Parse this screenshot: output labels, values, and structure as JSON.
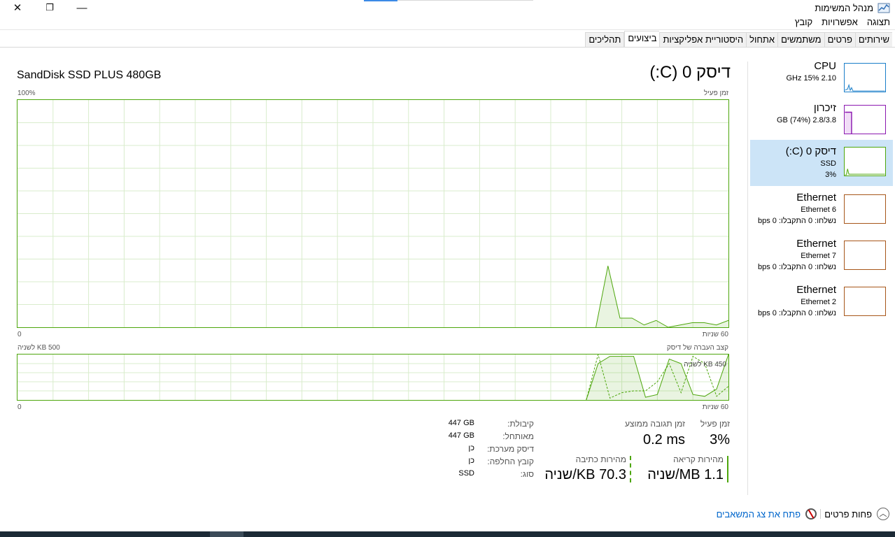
{
  "window": {
    "title": "מנהל המשימות",
    "controls": {
      "close": "✕",
      "restore": "❐",
      "minimize": "—"
    }
  },
  "menu": [
    "קובץ",
    "אפשרויות",
    "תצוגה"
  ],
  "tabs": [
    {
      "label": "תהליכים",
      "active": false
    },
    {
      "label": "ביצועים",
      "active": true
    },
    {
      "label": "היסטוריית אפליקציות",
      "active": false
    },
    {
      "label": "אתחול",
      "active": false
    },
    {
      "label": "משתמשים",
      "active": false
    },
    {
      "label": "פרטים",
      "active": false
    },
    {
      "label": "שירותים",
      "active": false
    }
  ],
  "resources": [
    {
      "name": "CPU",
      "line1": "2.10 GHz  15%",
      "line2": "",
      "color": "#1a7ec9",
      "selected": false
    },
    {
      "name": "זיכרון",
      "line1": "2.8/3.8 GB (74%)",
      "line2": "",
      "color": "#8b18b0",
      "selected": false
    },
    {
      "name": "דיסק 0 (C:)",
      "line1": "SSD",
      "line2": "3%",
      "color": "#4da60c",
      "selected": true
    },
    {
      "name": "Ethernet",
      "line1": "Ethernet 6",
      "line2": "נשלחו: 0 התקבלו: 0 bps",
      "color": "#a7561a",
      "selected": false
    },
    {
      "name": "Ethernet",
      "line1": "Ethernet 7",
      "line2": "נשלחו: 0 התקבלו: 0 bps",
      "color": "#a7561a",
      "selected": false
    },
    {
      "name": "Ethernet",
      "line1": "Ethernet 2",
      "line2": "נשלחו: 0 התקבלו: 0 bps",
      "color": "#a7561a",
      "selected": false
    }
  ],
  "disk": {
    "title": "דיסק 0 (C:)",
    "model": "SandDisk SSD PLUS 480GB",
    "active_time_label": "זמן פעיל",
    "active_time_max": "100%",
    "x_left_label": "60 שניות",
    "x_right_label": "0",
    "transfer_label": "קצב העברה של דיסק",
    "transfer_max": "500 KB לשניה",
    "transfer_marker": "450 KB לשניה",
    "active_time_series": [
      0,
      0,
      0,
      0,
      0,
      0,
      0,
      0,
      0,
      0,
      0,
      0,
      0,
      0,
      0,
      0,
      0,
      0,
      0,
      0,
      0,
      0,
      0,
      0,
      0,
      0,
      0,
      0,
      0,
      0,
      0,
      0,
      0,
      0,
      0,
      0,
      0,
      0,
      0,
      0,
      0,
      0,
      0,
      0,
      0,
      0,
      0,
      0,
      0,
      27,
      4,
      4,
      1,
      3,
      0,
      1,
      2,
      2,
      1,
      3
    ],
    "read_series": [
      0,
      0,
      0,
      0,
      0,
      0,
      0,
      0,
      0,
      0,
      0,
      0,
      0,
      0,
      0,
      0,
      0,
      0,
      0,
      0,
      0,
      0,
      0,
      0,
      0,
      0,
      0,
      0,
      0,
      0,
      0,
      0,
      0,
      0,
      0,
      0,
      0,
      0,
      0,
      0,
      0,
      0,
      0,
      0,
      0,
      0,
      0,
      0,
      0,
      400,
      480,
      480,
      480,
      30,
      60,
      450,
      400,
      60,
      40,
      120,
      500
    ],
    "write_series": [
      0,
      0,
      0,
      0,
      0,
      0,
      0,
      0,
      0,
      0,
      0,
      0,
      0,
      0,
      0,
      0,
      0,
      0,
      0,
      0,
      0,
      0,
      0,
      0,
      0,
      0,
      0,
      0,
      0,
      0,
      0,
      0,
      0,
      0,
      0,
      0,
      0,
      0,
      0,
      0,
      0,
      0,
      0,
      0,
      0,
      0,
      0,
      0,
      0,
      500,
      20,
      80,
      100,
      100,
      200,
      400,
      80,
      480,
      400,
      40,
      150
    ]
  },
  "stats": {
    "active_time_label": "זמן פעיל",
    "active_time_value": "3%",
    "avg_response_label": "זמן תגובה ממוצע",
    "avg_response_value": "0.2 ms",
    "read_speed_label": "מהירות קריאה",
    "read_speed_value": "1.1 MB/שניה",
    "write_speed_label": "מהירות כתיבה",
    "write_speed_value": "70.3 KB/שניה"
  },
  "properties": [
    {
      "label": "קיבולת:",
      "value": "447 GB"
    },
    {
      "label": "מאותחל:",
      "value": "447 GB"
    },
    {
      "label": "דיסק מערכת:",
      "value": "כן"
    },
    {
      "label": "קובץ החלפה:",
      "value": "כן"
    },
    {
      "label": "סוג:",
      "value": "SSD"
    }
  ],
  "footer": {
    "less_details": "פחות פרטים",
    "open_monitor": "פתח את צג המשאבים"
  }
}
